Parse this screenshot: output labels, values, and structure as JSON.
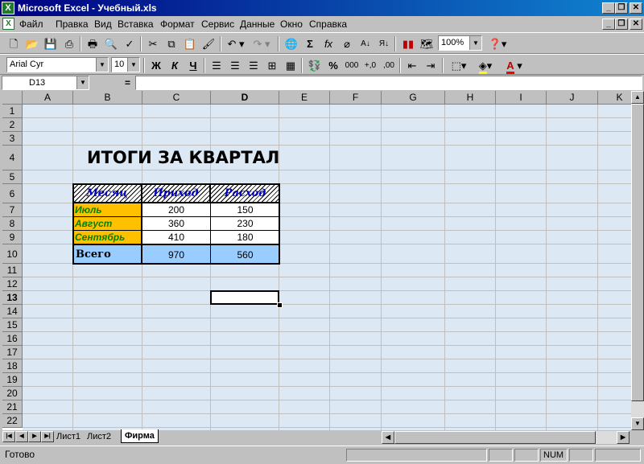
{
  "window": {
    "title": "Microsoft Excel - Учебный.xls",
    "app_icon": "X",
    "controls": [
      "_",
      "❐",
      "✕"
    ]
  },
  "menu": {
    "doc_icon": "X",
    "items": [
      "Файл",
      "Правка",
      "Вид",
      "Вставка",
      "Формат",
      "Сервис",
      "Данные",
      "Окно",
      "Справка"
    ],
    "doc_controls": [
      "_",
      "❐",
      "✕"
    ]
  },
  "toolbar_standard": {
    "zoom": "100%",
    "icons": [
      "new-icon",
      "open-icon",
      "save-icon",
      "permission-icon",
      "print-icon",
      "print-preview-icon",
      "spelling-icon",
      "cut-icon",
      "copy-icon",
      "paste-icon",
      "format-painter-icon",
      "undo-icon",
      "redo-icon",
      "hyperlink-icon",
      "autosum-icon",
      "function-icon",
      "clear-icon",
      "sort-asc-icon",
      "sort-desc-icon",
      "chart-wizard-icon",
      "map-icon",
      "help-icon"
    ]
  },
  "toolbar_format": {
    "font": "Arial Cyr",
    "size": "10",
    "bold": "Ж",
    "italic": "К",
    "underline": "Ч",
    "percent": "%",
    "thousands": "000",
    "inc_decimal": "+,0",
    "dec_decimal": ",00",
    "font_color_label": "A"
  },
  "formula_bar": {
    "name_box": "D13",
    "equals": "=",
    "content": ""
  },
  "columns": [
    "A",
    "B",
    "C",
    "D",
    "E",
    "F",
    "G",
    "H",
    "I",
    "J",
    "K"
  ],
  "rows": [
    "1",
    "2",
    "3",
    "4",
    "5",
    "6",
    "7",
    "8",
    "9",
    "10",
    "11",
    "12",
    "13",
    "14",
    "15",
    "16",
    "17",
    "18",
    "19",
    "20",
    "21",
    "22"
  ],
  "sheet": {
    "title": "ИТОГИ ЗА КВАРТАЛ",
    "headers": [
      "Месяц",
      "Приход",
      "Расход"
    ],
    "data": [
      {
        "month": "Июль",
        "income": "200",
        "expense": "150"
      },
      {
        "month": "Август",
        "income": "360",
        "expense": "230"
      },
      {
        "month": "Сентябрь",
        "income": "410",
        "expense": "180"
      }
    ],
    "total": {
      "label": "Всего",
      "income": "970",
      "expense": "560"
    }
  },
  "tabs": [
    "Лист1",
    "Лист2",
    "Фирма"
  ],
  "active_tab": "Фирма",
  "status": {
    "text": "Готово",
    "num": "NUM"
  },
  "colors": {
    "title_bar_start": "#000080",
    "title_bar_end": "#1084d0",
    "month_fill": "#ffc000",
    "month_text": "#008000",
    "total_fill": "#99ccff",
    "header_text": "#0000cc"
  }
}
